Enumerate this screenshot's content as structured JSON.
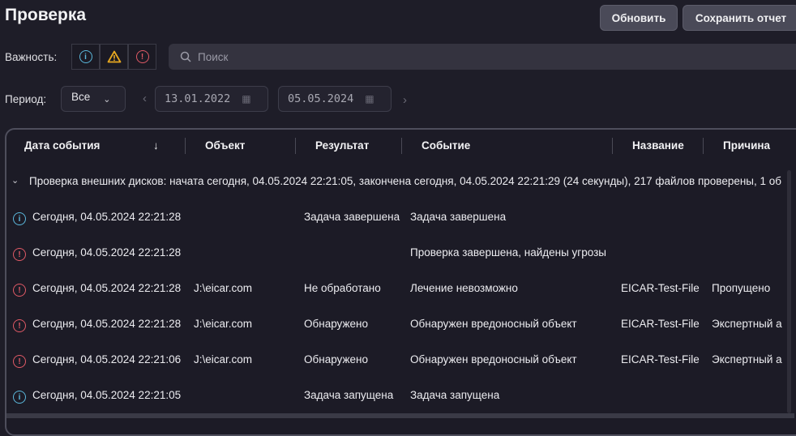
{
  "header": {
    "title": "Проверка",
    "refresh_label": "Обновить",
    "save_report_label": "Сохранить отчет"
  },
  "filters": {
    "severity_label": "Важность:",
    "severity_icons": [
      "info-icon",
      "warning-icon",
      "error-icon"
    ],
    "search_placeholder": "Поиск",
    "period_label": "Период:",
    "period_value": "Все",
    "date_from": "13.01.2022",
    "date_to": "05.05.2024"
  },
  "colors": {
    "info": "#5bb8dc",
    "warning": "#e8a820",
    "error": "#e05a66"
  },
  "table": {
    "columns": [
      "Дата события",
      "Объект",
      "Результат",
      "Событие",
      "Название",
      "Причина"
    ],
    "group": "Проверка внешних дисков: начата сегодня, 04.05.2024 22:21:05, закончена сегодня, 04.05.2024 22:21:29 (24 секунды), 217 файлов проверены, 1 об",
    "rows": [
      {
        "severity": "info",
        "date": "Сегодня, 04.05.2024 22:21:28",
        "object": "",
        "result": "Задача завершена",
        "event": "Задача завершена",
        "name": "",
        "reason": ""
      },
      {
        "severity": "error",
        "date": "Сегодня, 04.05.2024 22:21:28",
        "object": "",
        "result": "",
        "event": "Проверка завершена, найдены угрозы",
        "name": "",
        "reason": ""
      },
      {
        "severity": "error",
        "date": "Сегодня, 04.05.2024 22:21:28",
        "object": "J:\\eicar.com",
        "result": "Не обработано",
        "event": "Лечение невозможно",
        "name": "EICAR-Test-File",
        "reason": "Пропущено"
      },
      {
        "severity": "error",
        "date": "Сегодня, 04.05.2024 22:21:28",
        "object": "J:\\eicar.com",
        "result": "Обнаружено",
        "event": "Обнаружен вредоносный объект",
        "name": "EICAR-Test-File",
        "reason": "Экспертный а"
      },
      {
        "severity": "error",
        "date": "Сегодня, 04.05.2024 22:21:06",
        "object": "J:\\eicar.com",
        "result": "Обнаружено",
        "event": "Обнаружен вредоносный объект",
        "name": "EICAR-Test-File",
        "reason": "Экспертный а"
      },
      {
        "severity": "info",
        "date": "Сегодня, 04.05.2024 22:21:05",
        "object": "",
        "result": "Задача запущена",
        "event": "Задача запущена",
        "name": "",
        "reason": ""
      }
    ]
  }
}
